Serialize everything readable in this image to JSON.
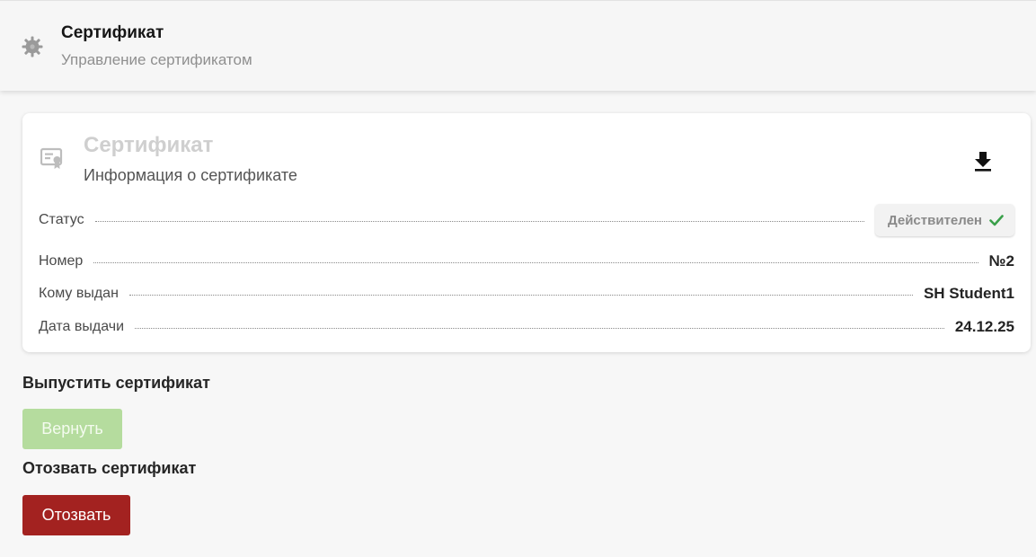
{
  "header": {
    "title": "Сертификат",
    "subtitle": "Управление сертификатом",
    "icon": "gear-icon"
  },
  "card": {
    "title": "Сертификат",
    "subtitle": "Информация о сертификате",
    "icon": "certificate-icon",
    "download_icon": "download-icon",
    "rows": [
      {
        "label": "Статус",
        "value": "Действителен"
      },
      {
        "label": "Номер",
        "value": "№2"
      },
      {
        "label": "Кому выдан",
        "value": "SH Student1"
      },
      {
        "label": "Дата выдачи",
        "value": "24.12.25"
      }
    ]
  },
  "actions": {
    "issue_title": "Выпустить сертификат",
    "return_label": "Вернуть",
    "revoke_title": "Отозвать сертификат",
    "revoke_label": "Отозвать"
  },
  "colors": {
    "status_ok": "#3aa04a",
    "return_button": "#b5dc9e",
    "revoke_button": "#a32220"
  }
}
